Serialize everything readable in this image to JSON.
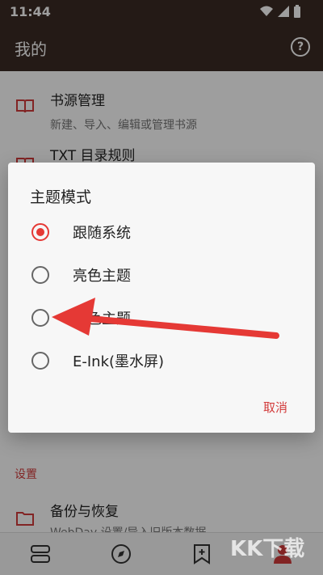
{
  "status_bar": {
    "time": "11:44"
  },
  "app_bar": {
    "title": "我的",
    "help_icon": "?"
  },
  "list": {
    "items": [
      {
        "title": "书源管理",
        "subtitle": "新建、导入、编辑或管理书源"
      },
      {
        "title": "TXT 目录规则",
        "subtitle": ""
      }
    ],
    "section_settings": "设置",
    "backup": {
      "title": "备份与恢复",
      "subtitle": "WebDav 设置/导入旧版本数据"
    }
  },
  "dialog": {
    "title": "主题模式",
    "options": [
      {
        "label": "跟随系统",
        "checked": true
      },
      {
        "label": "亮色主题",
        "checked": false
      },
      {
        "label": "暗色主题",
        "checked": false
      },
      {
        "label": "E-Ink(墨水屏)",
        "checked": false
      }
    ],
    "cancel_label": "取消"
  },
  "bottom_nav": [
    "bookshelf-icon",
    "explore-icon",
    "bookmark-add-icon",
    "profile-icon"
  ],
  "watermark": "KK下载",
  "colors": {
    "accent": "#e53935",
    "appbar": "#3b2a24",
    "cancel": "#d23b3b"
  }
}
